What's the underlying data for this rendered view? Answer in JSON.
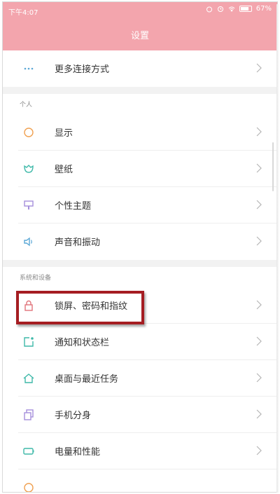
{
  "status_bar": {
    "time": "下午4:07",
    "battery": "67%"
  },
  "header": {
    "title": "设置"
  },
  "rows_top": [
    {
      "label": "更多连接方式",
      "icon": "more-dots-icon",
      "color": "#5aa7d6"
    }
  ],
  "sections": [
    {
      "title": "个人",
      "items": [
        {
          "label": "显示",
          "icon": "display-sun-icon",
          "color": "#f0a050"
        },
        {
          "label": "壁纸",
          "icon": "wallpaper-icon",
          "color": "#3fb9a9"
        },
        {
          "label": "个性主题",
          "icon": "theme-brush-icon",
          "color": "#a58fdc"
        },
        {
          "label": "声音和振动",
          "icon": "speaker-icon",
          "color": "#5aa7d6"
        }
      ]
    },
    {
      "title": "系统和设备",
      "items": [
        {
          "label": "锁屏、密码和指纹",
          "icon": "lock-icon",
          "color": "#e0737a"
        },
        {
          "label": "通知和状态栏",
          "icon": "notification-icon",
          "color": "#3fb9a9"
        },
        {
          "label": "桌面与最近任务",
          "icon": "home-icon",
          "color": "#3fb9a9"
        },
        {
          "label": "手机分身",
          "icon": "dual-phone-icon",
          "color": "#a58fdc"
        },
        {
          "label": "电量和性能",
          "icon": "battery-icon",
          "color": "#3fb9a9"
        }
      ]
    }
  ],
  "colors": {
    "header": "#f3a5ad",
    "highlight_border": "#a51d22"
  }
}
